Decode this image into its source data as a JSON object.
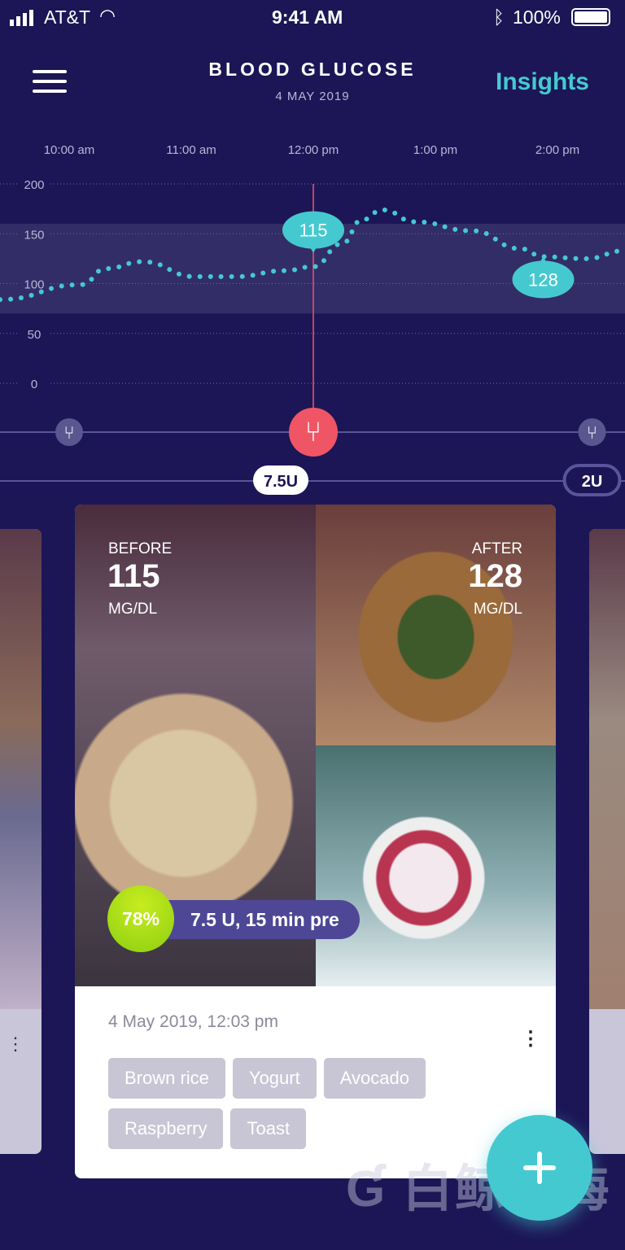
{
  "status": {
    "carrier": "AT&T",
    "time": "9:41 AM",
    "battery": "100%"
  },
  "header": {
    "title": "BLOOD GLUCOSE",
    "date": "4 MAY 2019",
    "insights_label": "Insights",
    "menu_icon": "hamburger-icon"
  },
  "colors": {
    "background": "#1c1656",
    "accent": "#45c9d0",
    "meal_active": "#f05566",
    "score": "#9ed60f"
  },
  "chart_data": {
    "type": "line",
    "x_ticks": [
      "10:00 am",
      "11:00 am",
      "12:00 pm",
      "1:00 pm",
      "2:00 pm"
    ],
    "y_ticks": [
      200,
      150,
      100,
      50,
      0
    ],
    "ylim": [
      0,
      200
    ],
    "target_range": [
      70,
      160
    ],
    "grid": true,
    "series": [
      {
        "x": [
          "9:26",
          "10:06",
          "10:18",
          "10:36",
          "11:02",
          "11:22",
          "11:46",
          "12:00",
          "12:14",
          "12:24",
          "12:34",
          "12:50",
          "13:18",
          "13:42",
          "13:53",
          "14:14",
          "14:33"
        ],
        "values": [
          84,
          99,
          115,
          122,
          107,
          107,
          113,
          117,
          140,
          164,
          174,
          162,
          153,
          135,
          127,
          125,
          133
        ]
      }
    ],
    "callouts": [
      {
        "x": "12:00",
        "value": "115"
      },
      {
        "x": "13:53",
        "value": "128"
      }
    ],
    "cursor_x": "12:00",
    "meals": [
      {
        "x": "10:00",
        "active": false
      },
      {
        "x": "12:00",
        "active": true
      },
      {
        "x": "14:17",
        "active": false
      }
    ],
    "insulin": [
      {
        "x": "11:44",
        "label": "7.5U",
        "filled": true
      },
      {
        "x": "14:17",
        "label": "2U",
        "filled": false
      }
    ]
  },
  "card": {
    "before_label": "BEFORE",
    "before_value": "115",
    "before_unit": "MG/DL",
    "after_label": "AFTER",
    "after_value": "128",
    "after_unit": "MG/DL",
    "score": "78%",
    "dose": "7.5 U, 15 min pre",
    "timestamp": "4 May 2019, 12:03 pm",
    "tags": [
      "Brown rice",
      "Yogurt",
      "Avocado",
      "Raspberry",
      "Toast"
    ]
  },
  "watermark": "白鲸出海"
}
